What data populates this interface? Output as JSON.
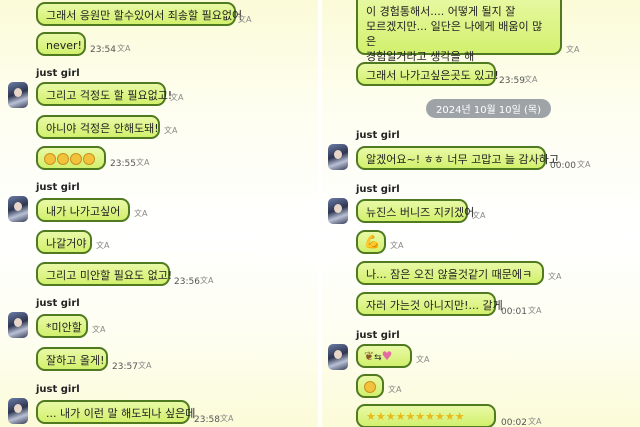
{
  "left": {
    "b1": "그래서 응원만 할수있어서 죄송할 필요없어",
    "b2": "never!",
    "t2": "23:54",
    "name1": "just girl",
    "b3": "그리고 걱정도 할 필요없고!",
    "b4": "아니야 걱정은 안해도돼!",
    "t5": "23:55",
    "name2": "just girl",
    "b6": "내가 나가고싶어",
    "b7": "나갈거야",
    "b8": "그리고 미안할 필요도 없고!",
    "t8": "23:56",
    "name3": "just girl",
    "b9": "*미안할",
    "b10": "잘하고 올게!",
    "t10": "23:57",
    "name4": "just girl",
    "b11": "... 내가 이런 말 해도되나 싶은데",
    "t11": "23:58"
  },
  "right": {
    "b1_l1": "이 경험통해서.... 어떻게 될지 잘",
    "b1_l2": "모르겠지만... 일단은 나에게 배움이 많은",
    "b1_l3": "경험일거라고 생각을 해",
    "b2": "그래서 나가고싶은곳도 있고!",
    "t2": "23:59",
    "date": "2024년 10월 10일 (목)",
    "name1": "just girl",
    "b3": "알겠어요~! ㅎㅎ 너무 고맙고 늘 감사하고",
    "t3": "00:00",
    "name2": "just girl",
    "b4": "뉴진스 버니즈 지키겠어",
    "b6": "나... 잠은 오진 않을것같기 때문에ㅋ",
    "b7": "자러 가는것 아니지만!... 갈게",
    "t7": "00:01",
    "name3": "just girl",
    "t10": "00:02"
  },
  "icons": [
    "translate-icon",
    "avatar",
    "smile-emoji",
    "flexed-biceps-emoji",
    "star-emoji",
    "heart-emoji"
  ]
}
